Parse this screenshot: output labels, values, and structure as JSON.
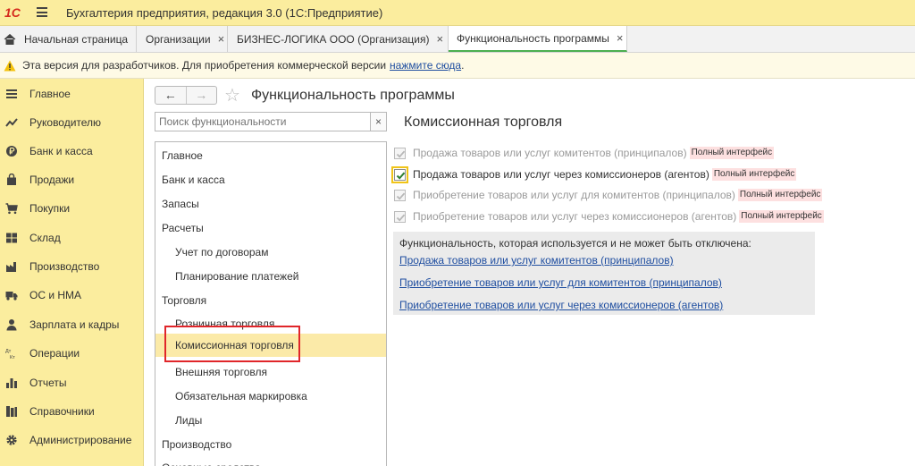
{
  "app": {
    "logo_text": "1С",
    "window_title": "Бухгалтерия предприятия, редакция 3.0  (1С:Предприятие)"
  },
  "tabs": [
    {
      "label": "Начальная страница",
      "closable": false,
      "active": false
    },
    {
      "label": "Организации",
      "closable": true,
      "active": false
    },
    {
      "label": "БИЗНЕС-ЛОГИКА ООО (Организация)",
      "closable": true,
      "active": false
    },
    {
      "label": "Функциональность программы",
      "closable": true,
      "active": true
    }
  ],
  "close_glyph": "×",
  "warning": {
    "text": "Эта версия для разработчиков. Для приобретения коммерческой версии",
    "link": "нажмите сюда",
    "suffix": "."
  },
  "sidebar": {
    "items": [
      {
        "label": "Главное",
        "icon": "menu-icon"
      },
      {
        "label": "Руководителю",
        "icon": "chart-trend-icon"
      },
      {
        "label": "Банк и касса",
        "icon": "ruble-coin-icon"
      },
      {
        "label": "Продажи",
        "icon": "shopping-bag-icon"
      },
      {
        "label": "Покупки",
        "icon": "cart-icon"
      },
      {
        "label": "Склад",
        "icon": "warehouse-icon"
      },
      {
        "label": "Производство",
        "icon": "factory-icon"
      },
      {
        "label": "ОС и НМА",
        "icon": "truck-icon"
      },
      {
        "label": "Зарплата и кадры",
        "icon": "person-icon"
      },
      {
        "label": "Операции",
        "icon": "dt-kt-icon"
      },
      {
        "label": "Отчеты",
        "icon": "bar-chart-icon"
      },
      {
        "label": "Справочники",
        "icon": "books-icon"
      },
      {
        "label": "Администрирование",
        "icon": "gear-icon"
      }
    ]
  },
  "main": {
    "nav_back": "←",
    "nav_forward": "→",
    "favorite_glyph": "☆",
    "title": "Функциональность программы",
    "search_placeholder": "Поиск функциональности",
    "search_clear": "×",
    "tree": [
      {
        "label": "Главное",
        "level": 0,
        "selected": false
      },
      {
        "label": "Банк и касса",
        "level": 0,
        "selected": false
      },
      {
        "label": "Запасы",
        "level": 0,
        "selected": false
      },
      {
        "label": "Расчеты",
        "level": 0,
        "selected": false
      },
      {
        "label": "Учет по договорам",
        "level": 1,
        "selected": false
      },
      {
        "label": "Планирование платежей",
        "level": 1,
        "selected": false
      },
      {
        "label": "Торговля",
        "level": 0,
        "selected": false
      },
      {
        "label": "Розничная торговля",
        "level": 1,
        "selected": false
      },
      {
        "label": "Комиссионная торговля",
        "level": 1,
        "selected": true
      },
      {
        "label": "Внешняя торговля",
        "level": 1,
        "selected": false
      },
      {
        "label": "Обязательная маркировка",
        "level": 1,
        "selected": false
      },
      {
        "label": "Лиды",
        "level": 1,
        "selected": false
      },
      {
        "label": "Производство",
        "level": 0,
        "selected": false
      },
      {
        "label": "Основные средства",
        "level": 0,
        "selected": false
      }
    ],
    "section_title": "Комиссионная торговля",
    "options": [
      {
        "label": "Продажа товаров или услуг комитентов (принципалов)",
        "badge": "Полный интерфейс",
        "checked": true,
        "enabled": false
      },
      {
        "label": "Продажа товаров или услуг через комиссионеров (агентов)",
        "badge": "Полный интерфейс",
        "checked": true,
        "enabled": true
      },
      {
        "label": "Приобретение товаров или услуг для комитентов (принципалов)",
        "badge": "Полный интерфейс",
        "checked": true,
        "enabled": false
      },
      {
        "label": "Приобретение товаров или услуг через комиссионеров (агентов)",
        "badge": "Полный интерфейс",
        "checked": true,
        "enabled": false
      }
    ],
    "info": {
      "caption": "Функциональность, которая используется и не может быть отключена:",
      "links": [
        "Продажа товаров или услуг комитентов (принципалов)",
        "Приобретение товаров или услуг для комитентов (принципалов)",
        "Приобретение товаров или услуг через комиссионеров (агентов)"
      ]
    }
  },
  "colors": {
    "sidebar_bg": "#fbed9e",
    "selection_bg": "#fbeaa8",
    "link": "#1f4ea0",
    "badge_bg": "#fde0e0",
    "highlight_frame": "#e0262a"
  }
}
